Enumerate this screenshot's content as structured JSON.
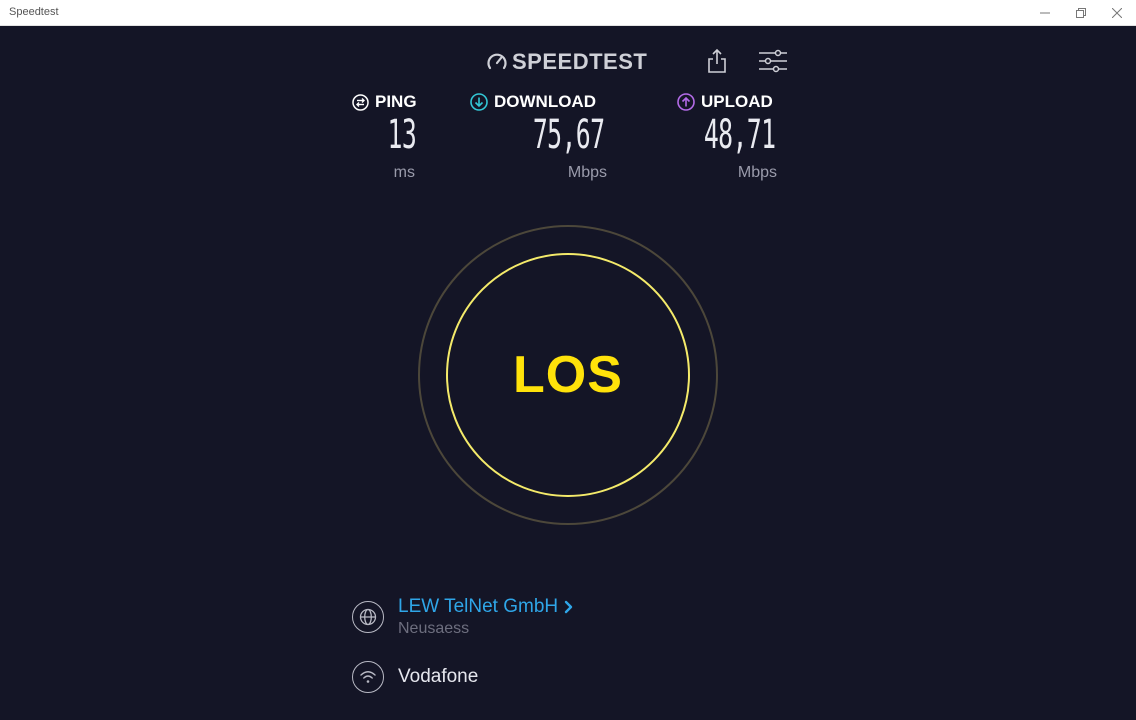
{
  "window": {
    "title": "Speedtest"
  },
  "brand": {
    "logo_text": "SPEEDTEST"
  },
  "metrics": {
    "ping": {
      "label": "PING",
      "value": "13",
      "unit": "ms",
      "color": "#ffffff"
    },
    "download": {
      "label": "DOWNLOAD",
      "value": "75,67",
      "unit": "Mbps",
      "color": "#33c7d6"
    },
    "upload": {
      "label": "UPLOAD",
      "value": "48,71",
      "unit": "Mbps",
      "color": "#b46be8"
    }
  },
  "go_button": {
    "label": "LOS"
  },
  "provider": {
    "name": "LEW TelNet GmbH",
    "location": "Neusaess"
  },
  "network": {
    "name": "Vodafone"
  },
  "colors": {
    "background": "#141526",
    "accent_yellow": "#ffe20a",
    "link_blue": "#2fa6e8"
  }
}
